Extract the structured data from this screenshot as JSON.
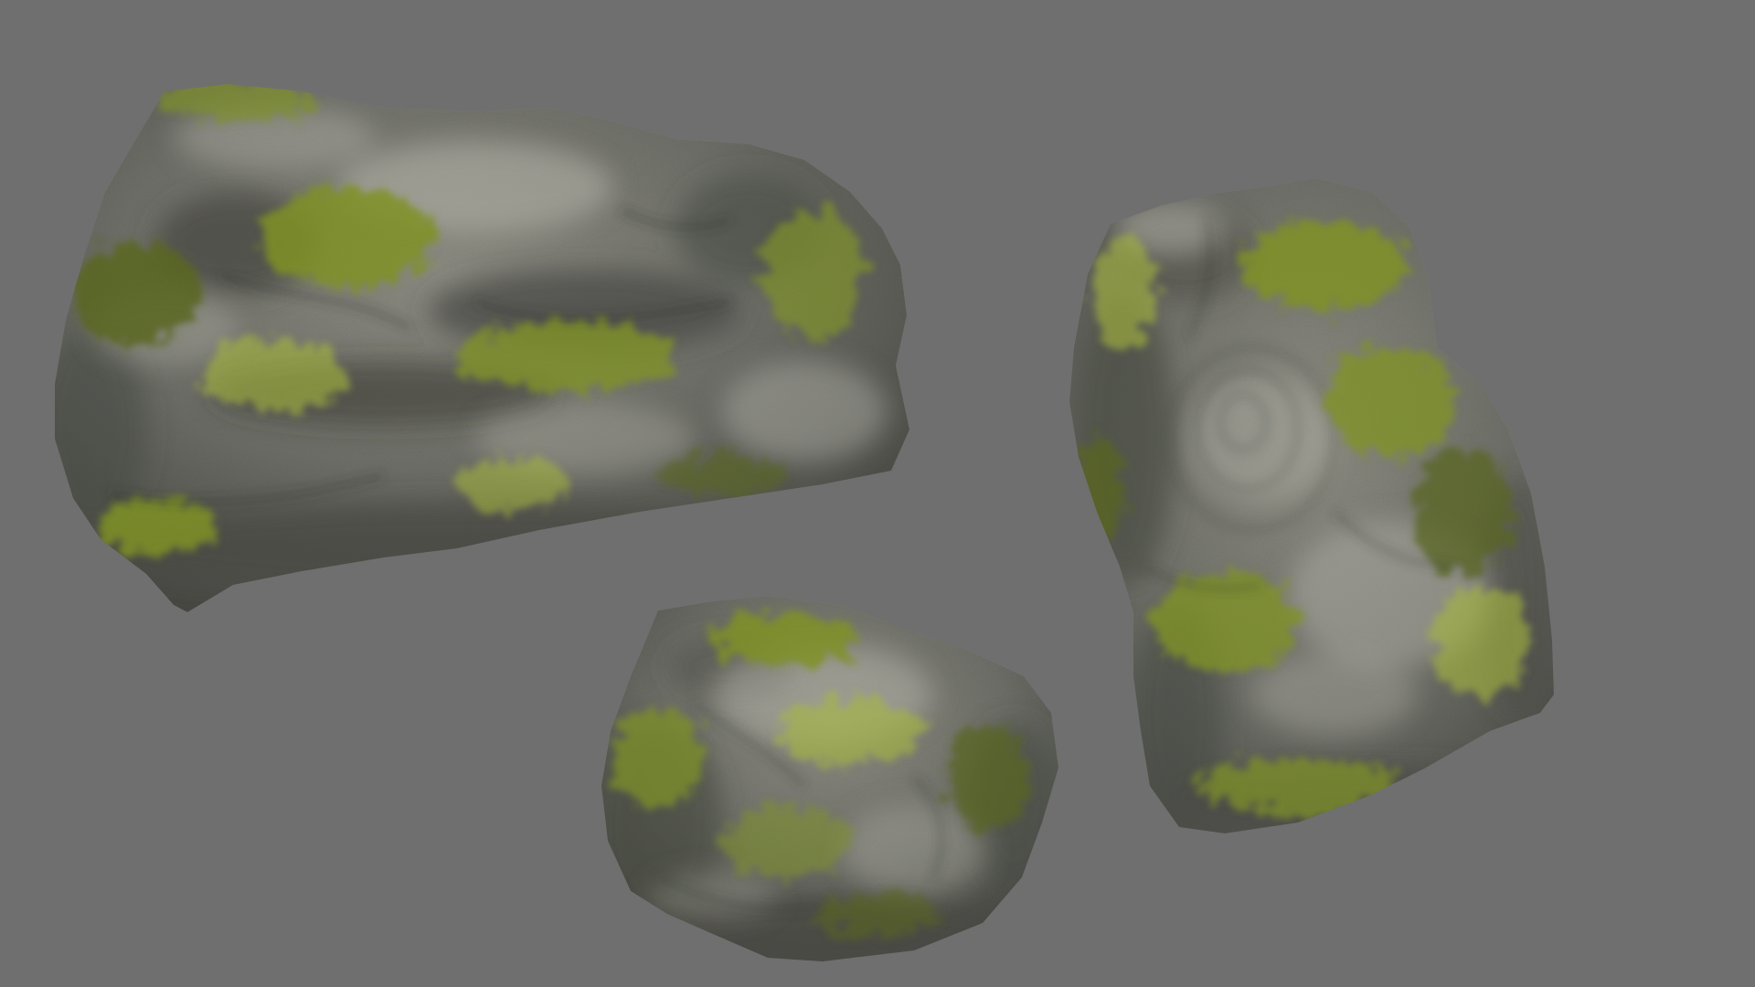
{
  "scene": {
    "background_color": "#6f6f6f",
    "rock_colors": {
      "highlight": "#b4b4aa",
      "stone_light": "#8e8e84",
      "stone": "#6f7069",
      "stone_dark": "#4a4b45",
      "crevice": "#2f302b"
    },
    "moss_colors": {
      "bright": "#a6b83a",
      "mid": "#7f9227",
      "dark": "#59661f"
    },
    "rocks": [
      {
        "name": "large-flat-boulder"
      },
      {
        "name": "small-round-rock"
      },
      {
        "name": "tall-upright-rock"
      }
    ]
  }
}
